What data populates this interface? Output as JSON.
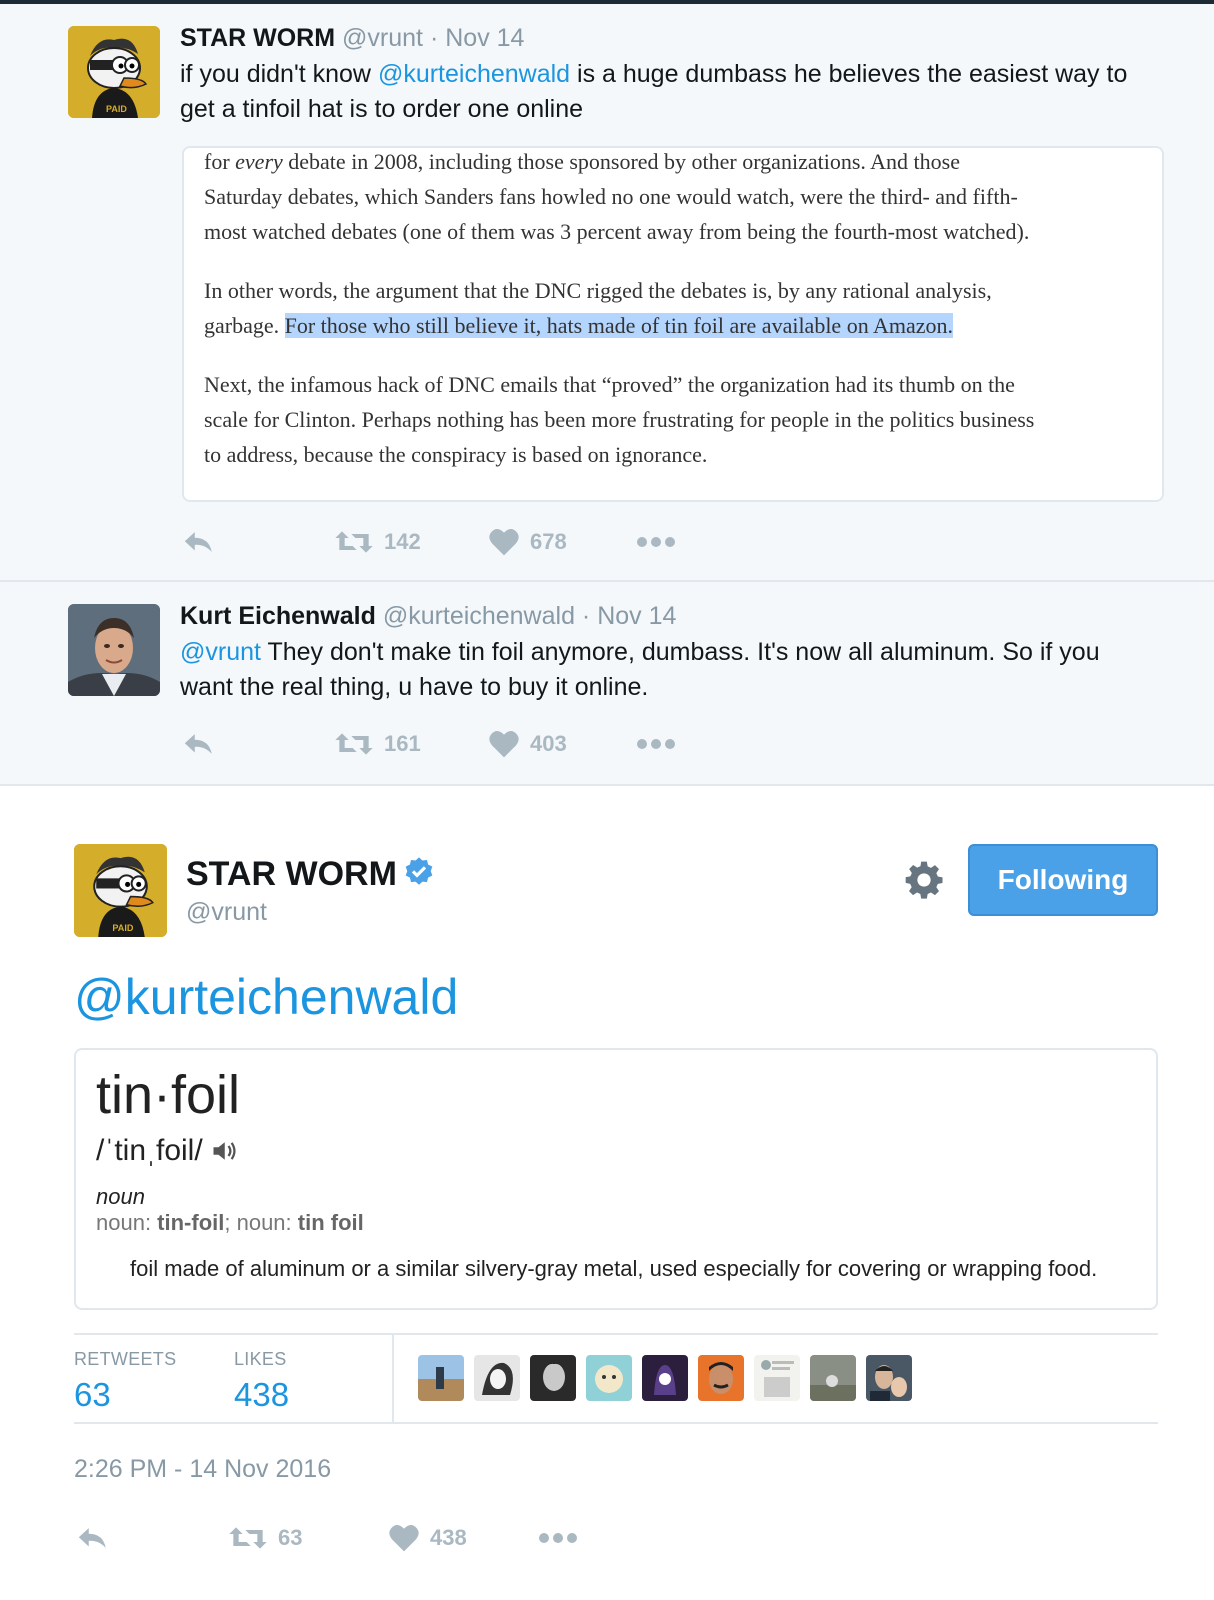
{
  "thread": [
    {
      "name": "STAR WORM",
      "handle": "@vrunt",
      "time": "Nov 14",
      "text_before": "if you didn't know ",
      "mention": "@kurteichenwald",
      "text_after": " is a huge dumbass he believes the easiest way to get a tinfoil hat is to order one online",
      "quote": {
        "p1_a": "for ",
        "p1_em": "every",
        "p1_b": " debate in 2008, including those sponsored by other organizations. And those",
        "p1_l2": "Saturday debates, which Sanders fans howled no one would watch, were the third- and fifth-",
        "p1_l3": "most watched debates (one of them was 3 percent away from being the fourth-most watched).",
        "p2_l1": "In other words, the argument that the DNC rigged the debates is, by any rational analysis,",
        "p2_l2a": "garbage. ",
        "p2_highlight": "For those who still believe it, hats made of tin foil are available on Amazon.",
        "p3_l1": "Next, the infamous hack of DNC emails that “proved” the organization had its thumb on the",
        "p3_l2": "scale for Clinton. Perhaps nothing has been more frustrating for people in the politics business",
        "p3_l3": "to address, because the conspiracy is based on ignorance."
      },
      "retweets": "142",
      "likes": "678"
    },
    {
      "name": "Kurt Eichenwald",
      "handle": "@kurteichenwald",
      "time": "Nov 14",
      "mention": "@vrunt",
      "text_after": " They don't make tin foil anymore, dumbass. It's now all aluminum. So if you want the real thing, u have to buy it online.",
      "retweets": "161",
      "likes": "403"
    }
  ],
  "main": {
    "name": "STAR WORM",
    "handle": "@vrunt",
    "follow_label": "Following",
    "mention": "@kurteichenwald",
    "dictionary": {
      "word": "tin·foil",
      "pronunciation": "/ˈtinˌfoil/",
      "part_of_speech": "noun",
      "forms_prefix": "noun: ",
      "form1": "tin-foil",
      "forms_mid": "; noun: ",
      "form2": "tin foil",
      "definition": "foil made of aluminum or a similar silvery-gray metal, used especially for covering or wrapping food."
    },
    "retweets_label": "RETWEETS",
    "retweets_count": "63",
    "likes_label": "LIKES",
    "likes_count": "438",
    "timestamp": "2:26 PM - 14 Nov 2016",
    "action_retweets": "63",
    "action_likes": "438"
  },
  "colors": {
    "link": "#1b95e0",
    "follow_button": "#4aa1e8",
    "verified": "#4aa1e8",
    "muted": "#8899a6",
    "thread_bg": "#f5f8fa",
    "highlight": "#b4d5fe"
  },
  "icons": [
    "reply-icon",
    "retweet-icon",
    "heart-icon",
    "more-icon",
    "gear-icon",
    "verified-icon",
    "speaker-icon"
  ]
}
